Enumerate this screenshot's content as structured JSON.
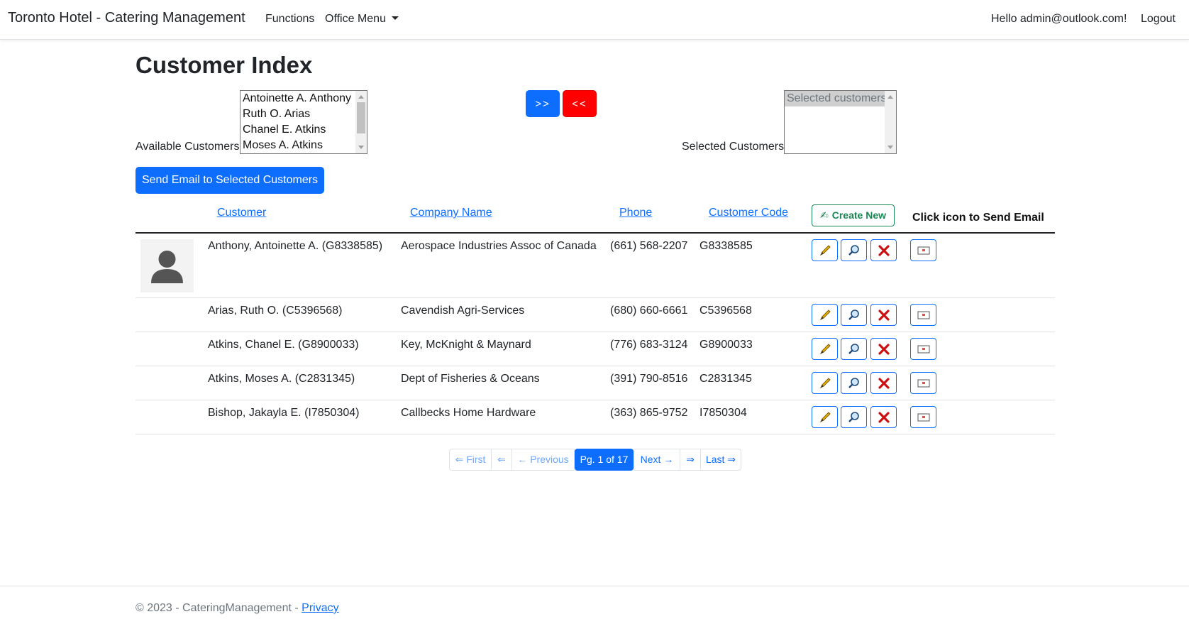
{
  "navbar": {
    "brand": "Toronto Hotel - Catering Management",
    "links": [
      "Functions",
      "Office Menu"
    ],
    "greeting": "Hello admin@outlook.com!",
    "logout": "Logout"
  },
  "page": {
    "title": "Customer Index"
  },
  "picker": {
    "available_label": "Available Customers",
    "available_options": [
      "Antoinette A. Anthony",
      "Ruth O. Arias",
      "Chanel E. Atkins",
      "Moses A. Atkins"
    ],
    "add_label": ">>",
    "remove_label": "<<",
    "selected_label": "Selected Customers",
    "selected_options": [
      "Selected customers"
    ]
  },
  "send_email_button": "Send Email to Selected Customers",
  "table": {
    "headers": {
      "customer": "Customer",
      "company": "Company Name",
      "phone": "Phone",
      "code": "Customer Code"
    },
    "create_new": "Create New",
    "email_hint": "Click icon to Send Email",
    "rows": [
      {
        "customer": "Anthony, Antoinette A. (G8338585)",
        "company": "Aerospace Industries Assoc of Canada",
        "phone": "(661) 568-2207",
        "code": "G8338585"
      },
      {
        "customer": "Arias, Ruth O. (C5396568)",
        "company": "Cavendish Agri-Services",
        "phone": "(680) 660-6661",
        "code": "C5396568"
      },
      {
        "customer": "Atkins, Chanel E. (G8900033)",
        "company": "Key, McKnight & Maynard",
        "phone": "(776) 683-3124",
        "code": "G8900033"
      },
      {
        "customer": "Atkins, Moses A. (C2831345)",
        "company": "Dept of Fisheries & Oceans",
        "phone": "(391) 790-8516",
        "code": "C2831345"
      },
      {
        "customer": "Bishop, Jakayla E. (I7850304)",
        "company": "Callbecks Home Hardware",
        "phone": "(363) 865-9752",
        "code": "I7850304"
      }
    ],
    "icons": {
      "edit": "pencil-icon",
      "details": "magnifier-icon",
      "delete": "x-icon",
      "email": "email-icon",
      "avatar": "user-silhouette-icon"
    }
  },
  "pagination": {
    "first": "⇐ First",
    "prev_arrow": "⇐",
    "previous": "← Previous",
    "current": "Pg. 1 of 17",
    "next": "Next →",
    "next_arrow": "⇒",
    "last": "Last ⇒"
  },
  "footer": {
    "text": "© 2023 - CateringManagement - ",
    "privacy": "Privacy"
  },
  "colors": {
    "primary": "#0d6efd",
    "danger": "#ff0000",
    "success": "#198754"
  }
}
